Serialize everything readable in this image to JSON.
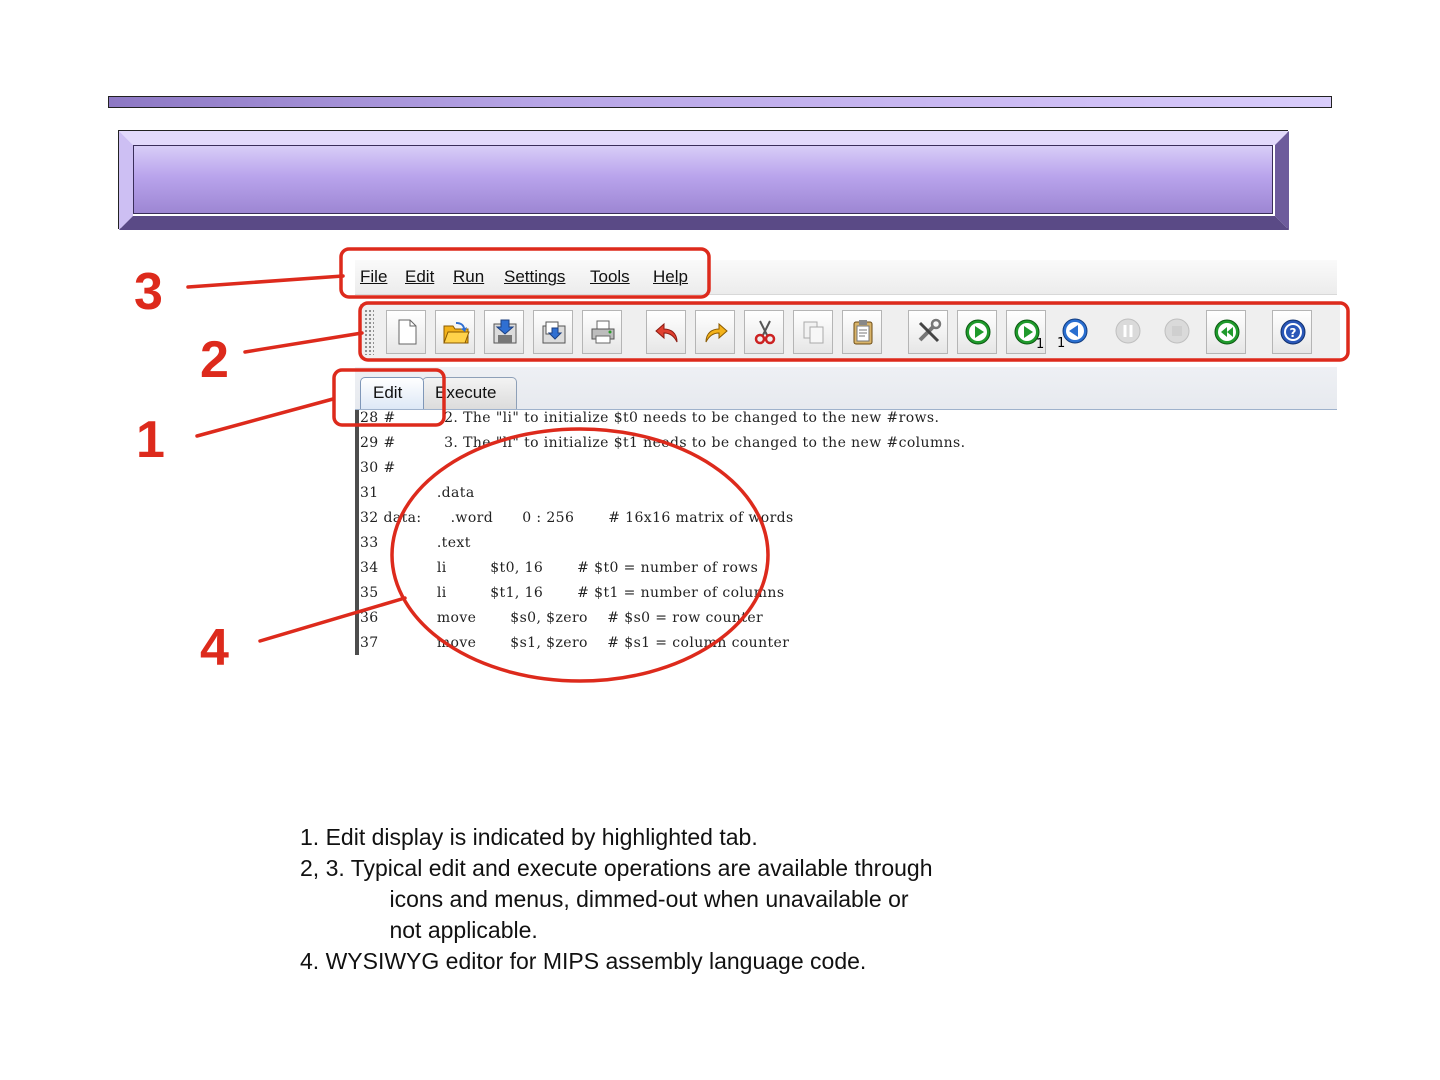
{
  "callouts": [
    "3",
    "2",
    "1",
    "4"
  ],
  "menu": {
    "items": [
      {
        "label": "File"
      },
      {
        "label": "Edit"
      },
      {
        "label": "Run"
      },
      {
        "label": "Settings"
      },
      {
        "label": "Tools"
      },
      {
        "label": "Help"
      }
    ]
  },
  "toolbar": {
    "buttons": [
      {
        "icon": "new-file-icon"
      },
      {
        "icon": "open-folder-icon"
      },
      {
        "icon": "save-icon"
      },
      {
        "icon": "save-as-icon"
      },
      {
        "icon": "print-icon"
      },
      {
        "icon": "undo-icon"
      },
      {
        "icon": "redo-icon"
      },
      {
        "icon": "cut-icon"
      },
      {
        "icon": "copy-icon"
      },
      {
        "icon": "paste-icon"
      },
      {
        "icon": "assemble-icon"
      },
      {
        "icon": "run-icon"
      },
      {
        "icon": "step-icon",
        "sub": "1"
      },
      {
        "icon": "backstep-icon",
        "sub": "1"
      },
      {
        "icon": "pause-icon",
        "state": "disabled"
      },
      {
        "icon": "stop-icon",
        "state": "disabled"
      },
      {
        "icon": "reset-icon"
      },
      {
        "icon": "help-icon"
      }
    ]
  },
  "tabs": [
    {
      "label": "Edit",
      "active": true
    },
    {
      "label": "Execute",
      "active": false
    }
  ],
  "editor": {
    "lines": [
      {
        "num": "28",
        "text": "#          2. The \"li\" to initialize $t0 needs to be changed to the new #rows."
      },
      {
        "num": "29",
        "text": "#          3. The \"li\" to initialize $t1 needs to be changed to the new #columns."
      },
      {
        "num": "30",
        "text": "#"
      },
      {
        "num": "31",
        "text": "           .data"
      },
      {
        "num": "32",
        "text": "data:      .word      0 : 256       # 16x16 matrix of words"
      },
      {
        "num": "33",
        "text": "           .text"
      },
      {
        "num": "34",
        "text": "           li         $t0, 16       # $t0 = number of rows"
      },
      {
        "num": "35",
        "text": "           li         $t1, 16       # $t1 = number of columns"
      },
      {
        "num": "36",
        "text": "           move       $s0, $zero    # $s0 = row counter"
      },
      {
        "num": "37",
        "text": "           move       $s1, $zero    # $s1 = column counter"
      }
    ]
  },
  "notes": [
    "1. Edit display is indicated by highlighted tab.",
    "2, 3. Typical edit and execute operations are available through",
    "              icons and menus, dimmed-out when unavailable or",
    "              not applicable.",
    "4. WYSIWYG editor for MIPS assembly language code."
  ],
  "colors": {
    "callout_red": "#dd2a1c",
    "banner_purple": "#b7a5e6",
    "run_green": "#1f9a2c",
    "help_blue": "#2a57b8"
  }
}
